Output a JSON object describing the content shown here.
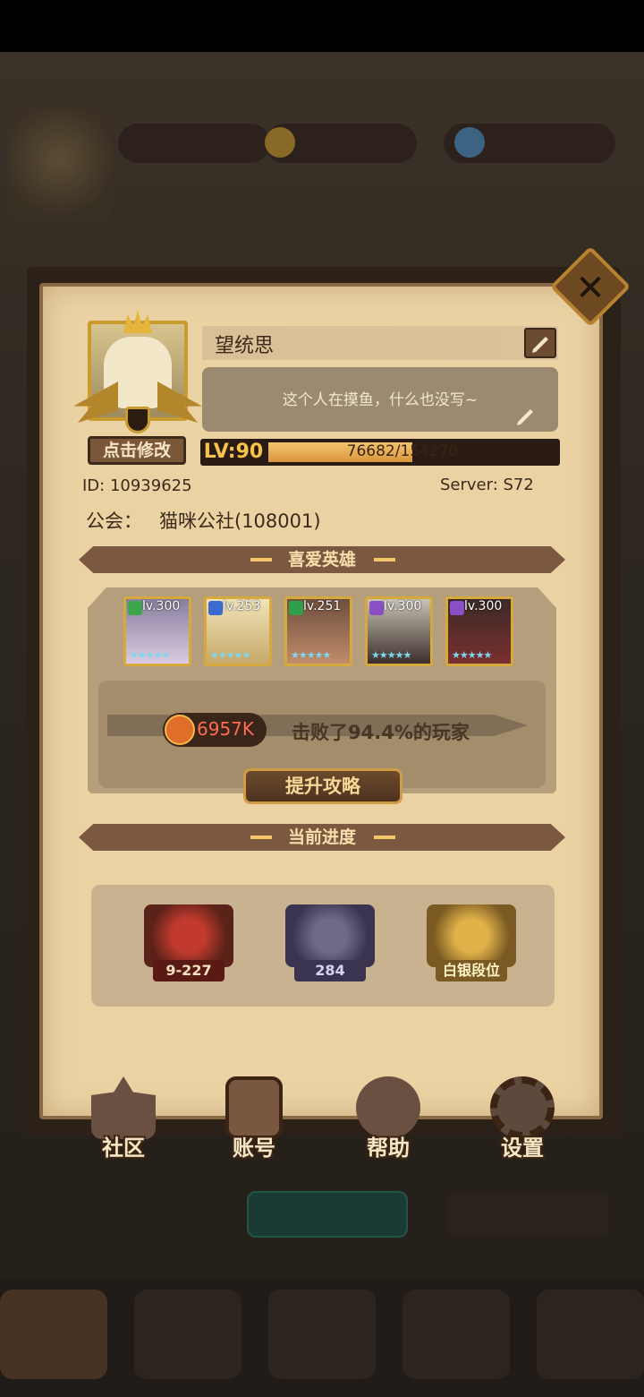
{
  "profile": {
    "name": "望统思",
    "signature": "这个人在摸鱼，什么也没写~",
    "modify_label": "点击修改",
    "level_label": "LV:90",
    "exp_text": "76682/154270",
    "exp_current": 76682,
    "exp_max": 154270,
    "id_label": "ID:  10939625",
    "server_label": "Server:  S72",
    "guild_label": "公会：",
    "guild_value": "猫咪公社(108001)"
  },
  "favorite_heroes": {
    "title": "喜爱英雄",
    "heroes": [
      {
        "level": "lv.300",
        "class_color": "#3aa84a"
      },
      {
        "level": "lv.253",
        "class_color": "#3b6ad0"
      },
      {
        "level": "lv.251",
        "class_color": "#2fa04a"
      },
      {
        "level": "lv.300",
        "class_color": "#8a4fc4"
      },
      {
        "level": "lv.300",
        "class_color": "#8a4fc4"
      }
    ],
    "stars": "★★★★★",
    "power": "6957K",
    "defeat_text": "击败了94.4%的玩家",
    "strategy_button": "提升攻略"
  },
  "progress": {
    "title": "当前进度",
    "items": [
      {
        "label": "9-227"
      },
      {
        "label": "284"
      },
      {
        "label": "白银段位"
      }
    ]
  },
  "nav": {
    "community": "社区",
    "account": "账号",
    "help": "帮助",
    "settings": "设置"
  },
  "close_icon": "close-icon",
  "colors": {
    "panel": "#ead2a3",
    "banner": "#7b583f",
    "accent_gold": "#d6a93c",
    "power_red": "#ff6b55"
  }
}
